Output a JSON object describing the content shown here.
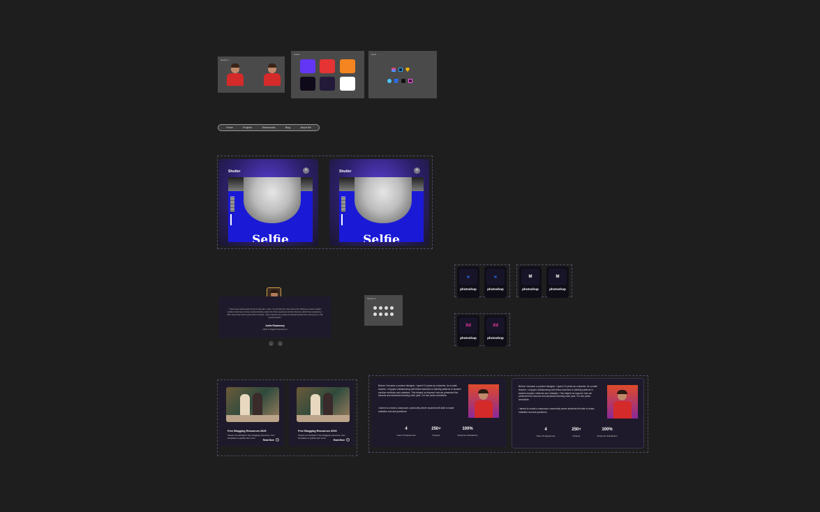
{
  "frames": {
    "section1_label": "Section 1",
    "colors_label": "Colors",
    "icons_label": "Icons",
    "section2_label": "Section 2"
  },
  "colors": [
    "#6336f5",
    "#e63333",
    "#f58520",
    "#0f0a1a",
    "#221a38",
    "#ffffff"
  ],
  "nav": {
    "items": [
      "Home",
      "Projects",
      "Testimonies",
      "Blog",
      "About Me"
    ]
  },
  "shutter": {
    "cards": [
      {
        "brand": "Shutter",
        "cover_title": "Selfie"
      },
      {
        "brand": "Shutter",
        "cover_title": "Selfie"
      }
    ]
  },
  "testimonial": {
    "quote": "\"I have been working with Jeremi for the past 7 years. It is the best job I have had so far. Working on super complex problems that have not been explored before makes the whole experience and the discovery rather than engineering. I think Jeremi has found a great team of people. I have enjoyed it as a great of professional who has a strong eye to craft a great product.\"",
    "name": "Justin Rhammony",
    "role": "CEO of Digital Solutions.io",
    "prev": "←",
    "next": "→"
  },
  "apps": {
    "cards": [
      {
        "label": "photoshop",
        "icon": "x-icon",
        "color": "#2b6ff7"
      },
      {
        "label": "photoshop",
        "icon": "x-icon",
        "color": "#2b6ff7"
      },
      {
        "label": "photoshop",
        "icon": "m-icon",
        "color": "#ffffff"
      },
      {
        "label": "photoshop",
        "icon": "m-icon",
        "color": "#ffffff"
      },
      {
        "label": "photoshop",
        "icon": "xd-icon",
        "color": "#ff3aa8"
      },
      {
        "label": "photoshop",
        "icon": "xd-icon",
        "color": "#ff3aa8"
      }
    ],
    "glyphs": {
      "x": "✕",
      "m": "M",
      "xd": "Xd"
    }
  },
  "blog": {
    "cards": [
      {
        "title": "Free Blogging Resources 2025",
        "desc": "Check out HubSpot's free blogging resources, from templates to guides and more.",
        "read_more": "Read More"
      },
      {
        "title": "Free Blogging Resources 2025",
        "desc": "Check out HubSpot's free blogging resources, from templates to guides and more.",
        "read_more": "Read More"
      }
    ]
  },
  "about": {
    "cards": [
      {
        "p1": "Before I became a product designer, I spent 10 years as a teacher. As a math teacher, I enjoyed collaborating with fellow teachers to identify patterns in student solution methods and mistakes. This helped us improve how we presented the lessons and assessed learning each year. For two years worldwide.",
        "p2": "I aimed to create a classroom community where students felt safe to make mistakes and ask questions.",
        "stats": [
          {
            "num": "4",
            "label": "Years Of Experience"
          },
          {
            "num": "250+",
            "label": "Projects"
          },
          {
            "num": "100%",
            "label": "Customer Satisfaction"
          }
        ]
      },
      {
        "p1": "Before I became a product designer, I spent 10 years as a teacher. As a math teacher, I enjoyed collaborating with fellow teachers to identify patterns in student solution methods and mistakes. This helped us improve how we presented the lessons and assessed learning each year. For two years worldwide.",
        "p2": "I aimed to create a classroom community where students felt safe to make mistakes and ask questions.",
        "stats": [
          {
            "num": "4",
            "label": "Years Of Experience"
          },
          {
            "num": "250+",
            "label": "Projects"
          },
          {
            "num": "100%",
            "label": "Customer Satisfaction"
          }
        ]
      }
    ]
  }
}
